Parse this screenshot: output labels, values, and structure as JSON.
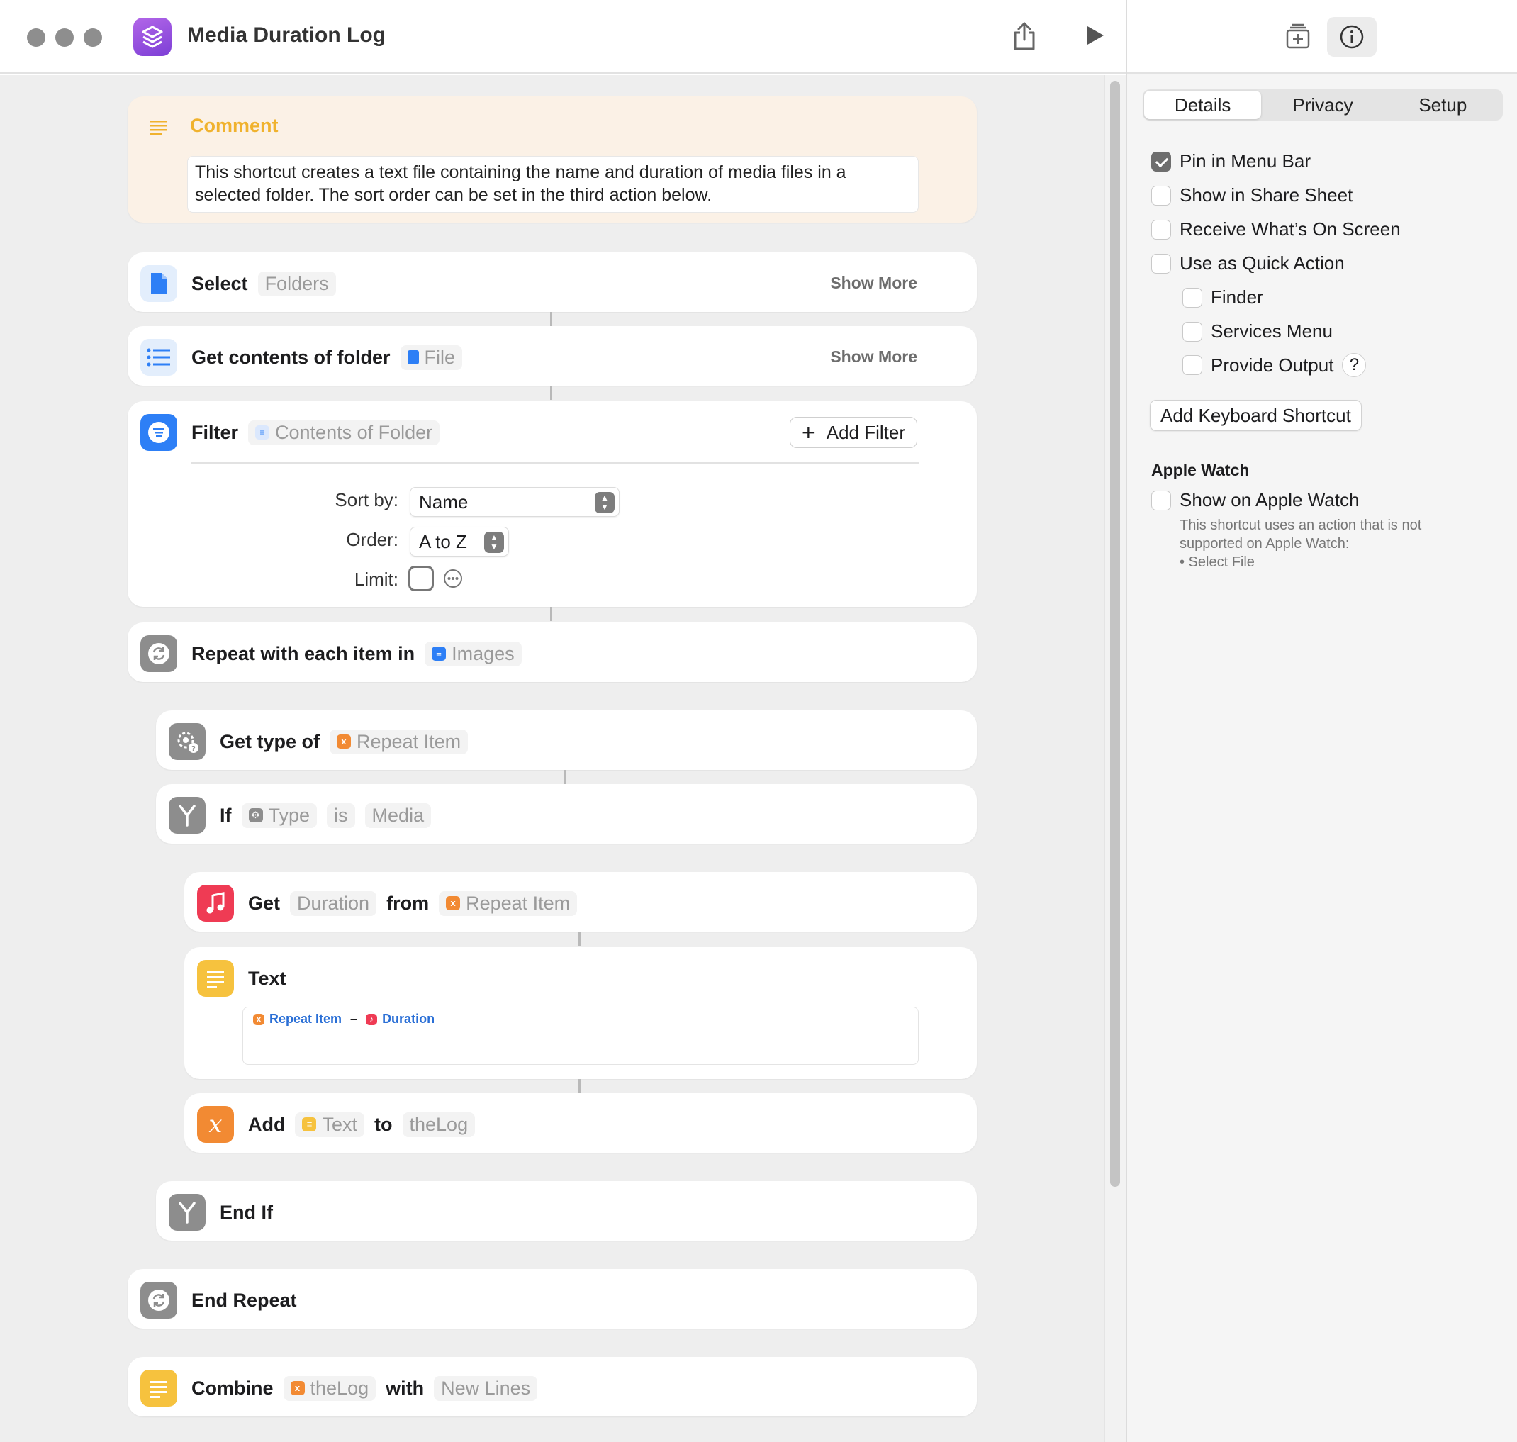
{
  "window": {
    "title": "Media Duration Log"
  },
  "toolbar": {
    "share_icon": "share-icon",
    "run_icon": "play-icon",
    "add_icon": "library-icon",
    "info_icon": "info-icon"
  },
  "comment": {
    "label": "Comment",
    "text": "This shortcut creates a text file containing the name and duration of media files in a selected folder. The sort order can be set in the third action below."
  },
  "actions": {
    "select": {
      "verb": "Select",
      "param": "Folders",
      "show_more": "Show More"
    },
    "get_contents": {
      "verb": "Get contents of folder",
      "param": "File",
      "show_more": "Show More"
    },
    "filter": {
      "verb": "Filter",
      "param": "Contents of Folder",
      "add_filter": "Add Filter",
      "sort_label": "Sort by:",
      "sort_value": "Name",
      "order_label": "Order:",
      "order_value": "A to Z",
      "limit_label": "Limit:"
    },
    "repeat": {
      "verb": "Repeat with each item in",
      "param": "Images"
    },
    "get_type": {
      "verb": "Get type of",
      "param": "Repeat Item"
    },
    "if": {
      "verb": "If",
      "param1": "Type",
      "op": "is",
      "param2": "Media"
    },
    "get_duration": {
      "verb": "Get",
      "param1": "Duration",
      "mid": "from",
      "param2": "Repeat Item"
    },
    "text": {
      "verb": "Text",
      "var1": "Repeat Item",
      "sep": "–",
      "var2": "Duration"
    },
    "add": {
      "verb": "Add",
      "param1": "Text",
      "mid": "to",
      "param2": "theLog"
    },
    "end_if": {
      "verb": "End If"
    },
    "end_repeat": {
      "verb": "End Repeat"
    },
    "combine": {
      "verb": "Combine",
      "param1": "theLog",
      "mid": "with",
      "param2": "New Lines"
    }
  },
  "inspector": {
    "tabs": [
      "Details",
      "Privacy",
      "Setup"
    ],
    "active_tab": "Details",
    "options": [
      {
        "label": "Pin in Menu Bar",
        "checked": true
      },
      {
        "label": "Show in Share Sheet",
        "checked": false
      },
      {
        "label": "Receive What’s On Screen",
        "checked": false
      },
      {
        "label": "Use as Quick Action",
        "checked": false
      }
    ],
    "quick_action_options": [
      {
        "label": "Finder",
        "checked": false
      },
      {
        "label": "Services Menu",
        "checked": false
      },
      {
        "label": "Provide Output",
        "checked": false
      }
    ],
    "help_glyph": "?",
    "keyboard_shortcut": "Add Keyboard Shortcut",
    "apple_watch": {
      "heading": "Apple Watch",
      "option": "Show on Apple Watch",
      "note_line1": "This shortcut uses an action that is not",
      "note_line2": "supported on Apple Watch:",
      "note_line3": "• Select File"
    }
  },
  "colors": {
    "blue": "#2d7ff6",
    "orange": "#f28a33",
    "yellow": "#f6c23e",
    "red": "#ef3b54",
    "gray_icon": "#8d8d8d",
    "comment_bg": "#fbf1e6",
    "comment_accent": "#f0b22e"
  }
}
